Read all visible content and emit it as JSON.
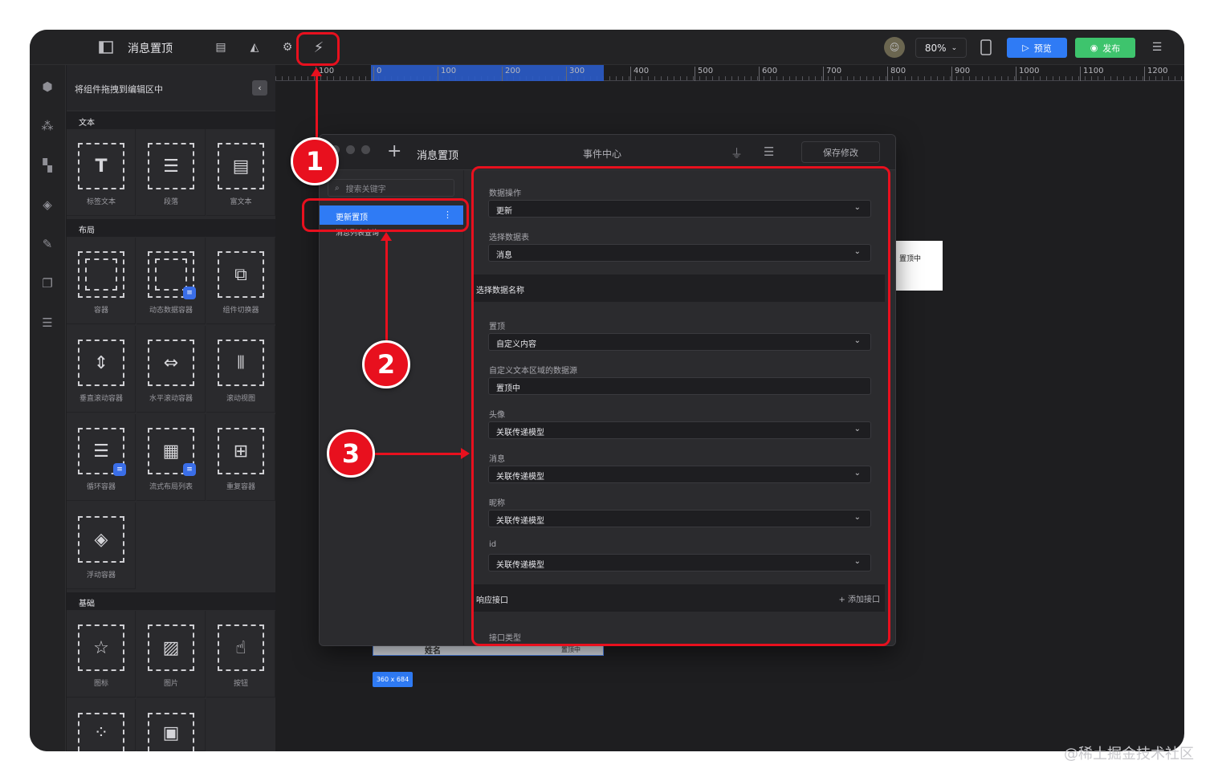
{
  "topbar": {
    "page_title": "消息置顶",
    "zoom": "80%",
    "preview_label": "预览",
    "publish_label": "发布"
  },
  "panel": {
    "hint": "将组件拖拽到编辑区中",
    "sections": {
      "text": "文本",
      "layout": "布局",
      "basic": "基础"
    },
    "components": {
      "label_text": "标签文本",
      "paragraph": "段落",
      "rich_text": "富文本",
      "container": "容器",
      "dynamic_container": "动态数据容器",
      "component_switcher": "组件切换器",
      "v_scroll": "垂直滚动容器",
      "h_scroll": "水平滚动容器",
      "scroll_view": "滚动视图",
      "loop_container": "循环容器",
      "flow_list": "流式布局列表",
      "repeat_container": "重复容器",
      "float_container": "浮动容器",
      "icon": "图标",
      "image": "图片",
      "button": "按钮"
    }
  },
  "ruler": {
    "ticks": [
      "100",
      "0",
      "100",
      "200",
      "300",
      "400",
      "500",
      "600",
      "700",
      "800",
      "900",
      "1000",
      "1100",
      "1200"
    ]
  },
  "canvas": {
    "selection_size": "360 x 684",
    "strip_name": "姓名",
    "strip_pin": "置顶中",
    "card_text": "置顶中"
  },
  "dialog": {
    "title": "消息置顶",
    "center": "事件中心",
    "save": "保存修改",
    "search_placeholder": "搜索关键字",
    "events": [
      "更新置顶",
      "消息列表查询"
    ],
    "fields": {
      "data_op_label": "数据操作",
      "data_op_value": "更新",
      "table_label": "选择数据表",
      "table_value": "消息",
      "group_name": "选择数据名称",
      "pin_label": "置顶",
      "pin_value": "自定义内容",
      "custom_source_label": "自定义文本区域的数据源",
      "custom_source_value": "置顶中",
      "avatar_label": "头像",
      "avatar_value": "关联传递模型",
      "message_label": "消息",
      "message_value": "关联传递模型",
      "nickname_label": "昵称",
      "nickname_value": "关联传递模型",
      "id_label": "id",
      "id_value": "关联传递模型",
      "response_group": "响应接口",
      "add_api": "添加接口",
      "api_type_label": "接口类型"
    }
  },
  "annotations": {
    "n1": "1",
    "n2": "2",
    "n3": "3",
    "color": "#e8101e"
  },
  "watermark": "@稀土掘金技术社区"
}
